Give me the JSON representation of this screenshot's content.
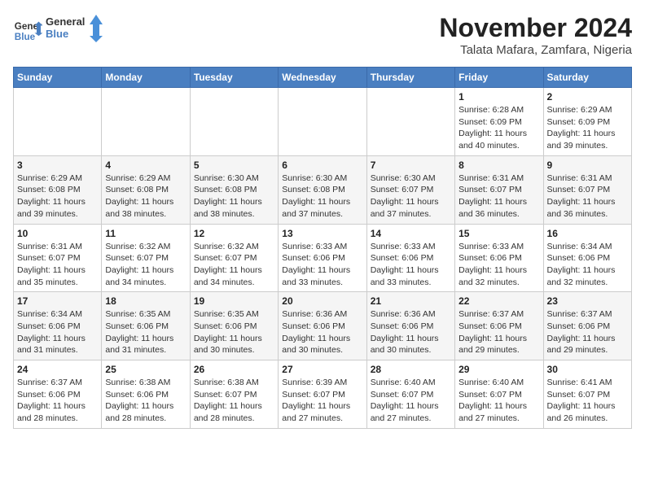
{
  "header": {
    "logo_line1": "General",
    "logo_line2": "Blue",
    "title": "November 2024",
    "subtitle": "Talata Mafara, Zamfara, Nigeria"
  },
  "weekdays": [
    "Sunday",
    "Monday",
    "Tuesday",
    "Wednesday",
    "Thursday",
    "Friday",
    "Saturday"
  ],
  "weeks": [
    [
      {
        "day": "",
        "info": ""
      },
      {
        "day": "",
        "info": ""
      },
      {
        "day": "",
        "info": ""
      },
      {
        "day": "",
        "info": ""
      },
      {
        "day": "",
        "info": ""
      },
      {
        "day": "1",
        "info": "Sunrise: 6:28 AM\nSunset: 6:09 PM\nDaylight: 11 hours\nand 40 minutes."
      },
      {
        "day": "2",
        "info": "Sunrise: 6:29 AM\nSunset: 6:09 PM\nDaylight: 11 hours\nand 39 minutes."
      }
    ],
    [
      {
        "day": "3",
        "info": "Sunrise: 6:29 AM\nSunset: 6:08 PM\nDaylight: 11 hours\nand 39 minutes."
      },
      {
        "day": "4",
        "info": "Sunrise: 6:29 AM\nSunset: 6:08 PM\nDaylight: 11 hours\nand 38 minutes."
      },
      {
        "day": "5",
        "info": "Sunrise: 6:30 AM\nSunset: 6:08 PM\nDaylight: 11 hours\nand 38 minutes."
      },
      {
        "day": "6",
        "info": "Sunrise: 6:30 AM\nSunset: 6:08 PM\nDaylight: 11 hours\nand 37 minutes."
      },
      {
        "day": "7",
        "info": "Sunrise: 6:30 AM\nSunset: 6:07 PM\nDaylight: 11 hours\nand 37 minutes."
      },
      {
        "day": "8",
        "info": "Sunrise: 6:31 AM\nSunset: 6:07 PM\nDaylight: 11 hours\nand 36 minutes."
      },
      {
        "day": "9",
        "info": "Sunrise: 6:31 AM\nSunset: 6:07 PM\nDaylight: 11 hours\nand 36 minutes."
      }
    ],
    [
      {
        "day": "10",
        "info": "Sunrise: 6:31 AM\nSunset: 6:07 PM\nDaylight: 11 hours\nand 35 minutes."
      },
      {
        "day": "11",
        "info": "Sunrise: 6:32 AM\nSunset: 6:07 PM\nDaylight: 11 hours\nand 34 minutes."
      },
      {
        "day": "12",
        "info": "Sunrise: 6:32 AM\nSunset: 6:07 PM\nDaylight: 11 hours\nand 34 minutes."
      },
      {
        "day": "13",
        "info": "Sunrise: 6:33 AM\nSunset: 6:06 PM\nDaylight: 11 hours\nand 33 minutes."
      },
      {
        "day": "14",
        "info": "Sunrise: 6:33 AM\nSunset: 6:06 PM\nDaylight: 11 hours\nand 33 minutes."
      },
      {
        "day": "15",
        "info": "Sunrise: 6:33 AM\nSunset: 6:06 PM\nDaylight: 11 hours\nand 32 minutes."
      },
      {
        "day": "16",
        "info": "Sunrise: 6:34 AM\nSunset: 6:06 PM\nDaylight: 11 hours\nand 32 minutes."
      }
    ],
    [
      {
        "day": "17",
        "info": "Sunrise: 6:34 AM\nSunset: 6:06 PM\nDaylight: 11 hours\nand 31 minutes."
      },
      {
        "day": "18",
        "info": "Sunrise: 6:35 AM\nSunset: 6:06 PM\nDaylight: 11 hours\nand 31 minutes."
      },
      {
        "day": "19",
        "info": "Sunrise: 6:35 AM\nSunset: 6:06 PM\nDaylight: 11 hours\nand 30 minutes."
      },
      {
        "day": "20",
        "info": "Sunrise: 6:36 AM\nSunset: 6:06 PM\nDaylight: 11 hours\nand 30 minutes."
      },
      {
        "day": "21",
        "info": "Sunrise: 6:36 AM\nSunset: 6:06 PM\nDaylight: 11 hours\nand 30 minutes."
      },
      {
        "day": "22",
        "info": "Sunrise: 6:37 AM\nSunset: 6:06 PM\nDaylight: 11 hours\nand 29 minutes."
      },
      {
        "day": "23",
        "info": "Sunrise: 6:37 AM\nSunset: 6:06 PM\nDaylight: 11 hours\nand 29 minutes."
      }
    ],
    [
      {
        "day": "24",
        "info": "Sunrise: 6:37 AM\nSunset: 6:06 PM\nDaylight: 11 hours\nand 28 minutes."
      },
      {
        "day": "25",
        "info": "Sunrise: 6:38 AM\nSunset: 6:06 PM\nDaylight: 11 hours\nand 28 minutes."
      },
      {
        "day": "26",
        "info": "Sunrise: 6:38 AM\nSunset: 6:07 PM\nDaylight: 11 hours\nand 28 minutes."
      },
      {
        "day": "27",
        "info": "Sunrise: 6:39 AM\nSunset: 6:07 PM\nDaylight: 11 hours\nand 27 minutes."
      },
      {
        "day": "28",
        "info": "Sunrise: 6:40 AM\nSunset: 6:07 PM\nDaylight: 11 hours\nand 27 minutes."
      },
      {
        "day": "29",
        "info": "Sunrise: 6:40 AM\nSunset: 6:07 PM\nDaylight: 11 hours\nand 27 minutes."
      },
      {
        "day": "30",
        "info": "Sunrise: 6:41 AM\nSunset: 6:07 PM\nDaylight: 11 hours\nand 26 minutes."
      }
    ]
  ]
}
